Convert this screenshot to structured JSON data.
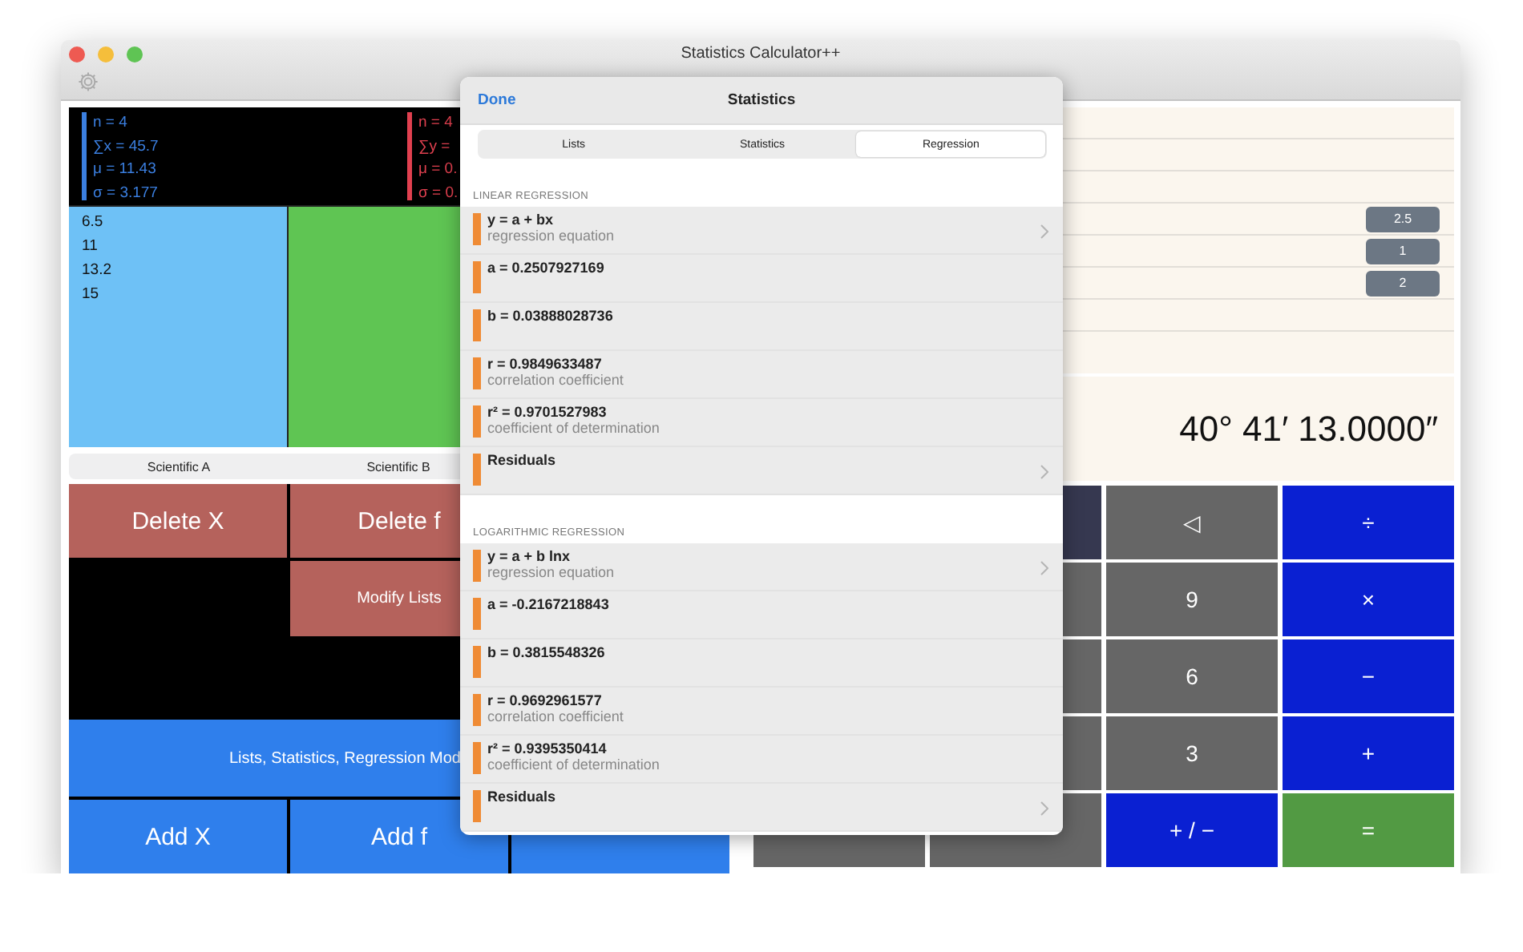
{
  "window": {
    "title": "Statistics Calculator++"
  },
  "stats_panels": [
    {
      "color": "#3b7fe0",
      "lines": [
        "n = 4",
        "∑x = 45.7",
        "μ = 11.43",
        "σ = 3.177"
      ]
    },
    {
      "color": "#e0404f",
      "lines": [
        "n = 4",
        "∑y =",
        "μ = 0.",
        "σ = 0."
      ]
    }
  ],
  "lists": [
    {
      "color": "#6ec1f6",
      "values": [
        "6.5",
        "11",
        "13.2",
        "15"
      ]
    },
    {
      "color": "#5fc553"
    }
  ],
  "mode_tabs": [
    {
      "label": "Scientific A"
    },
    {
      "label": "Scientific B"
    }
  ],
  "left_buttons": [
    {
      "kind": "delete",
      "label": "Delete X"
    },
    {
      "kind": "delete",
      "label": "Delete f"
    },
    {
      "kind": "gap"
    },
    {
      "kind": "gap"
    },
    {
      "kind": "modify",
      "label": "Modify Lists"
    },
    {
      "kind": "gap"
    },
    {
      "kind": "gap"
    },
    {
      "kind": "gap"
    },
    {
      "kind": "gap"
    },
    {
      "kind": "wide",
      "label": "Lists, Statistics, Regression Mod"
    },
    {
      "kind": "add",
      "label": "Add X"
    },
    {
      "kind": "add",
      "label": "Add f"
    },
    {
      "kind": "add"
    }
  ],
  "memory_values": [
    "2.5",
    "1",
    "2"
  ],
  "display": "40° 41′ 13.0000″",
  "keypad": [
    {
      "kind": "covered"
    },
    {
      "kind": "dark"
    },
    {
      "kind": "gray",
      "label": "◁"
    },
    {
      "kind": "blue",
      "label": "÷"
    },
    {
      "kind": "covered"
    },
    {
      "kind": "gray"
    },
    {
      "kind": "gray",
      "label": "9"
    },
    {
      "kind": "blue",
      "label": "×"
    },
    {
      "kind": "covered"
    },
    {
      "kind": "gray"
    },
    {
      "kind": "gray",
      "label": "6"
    },
    {
      "kind": "blue",
      "label": "−"
    },
    {
      "kind": "covered"
    },
    {
      "kind": "gray"
    },
    {
      "kind": "gray",
      "label": "3"
    },
    {
      "kind": "blue",
      "label": "+"
    },
    {
      "kind": "gray"
    },
    {
      "kind": "gray"
    },
    {
      "kind": "blue",
      "label": "+ / −"
    },
    {
      "kind": "green",
      "label": "="
    }
  ],
  "popover": {
    "done": "Done",
    "title": "Statistics",
    "tabs": [
      {
        "label": "Lists",
        "selected": false
      },
      {
        "label": "Statistics",
        "selected": false
      },
      {
        "label": "Regression",
        "selected": true
      }
    ],
    "sections": [
      {
        "header": "LINEAR REGRESSION",
        "rows": [
          {
            "title": "y = a + bx",
            "subtitle": "regression equation",
            "disclosure": true
          },
          {
            "title": "a = 0.2507927169",
            "disclosure": false
          },
          {
            "title": "b = 0.03888028736",
            "disclosure": false
          },
          {
            "title": "r = 0.9849633487",
            "subtitle": "correlation coefficient",
            "disclosure": false
          },
          {
            "title": "r² = 0.9701527983",
            "subtitle": "coefficient of determination",
            "disclosure": false
          },
          {
            "title": "Residuals",
            "disclosure": true
          }
        ]
      },
      {
        "header": "LOGARITHMIC REGRESSION",
        "rows": [
          {
            "title": "y = a + b lnx",
            "subtitle": "regression equation",
            "disclosure": true
          },
          {
            "title": "a = -0.2167218843",
            "disclosure": false
          },
          {
            "title": "b = 0.3815548326",
            "disclosure": false
          },
          {
            "title": "r = 0.9692961577",
            "subtitle": "correlation coefficient",
            "disclosure": false
          },
          {
            "title": "r² = 0.9395350414",
            "subtitle": "coefficient of determination",
            "disclosure": false
          },
          {
            "title": "Residuals",
            "disclosure": true
          }
        ]
      }
    ]
  }
}
